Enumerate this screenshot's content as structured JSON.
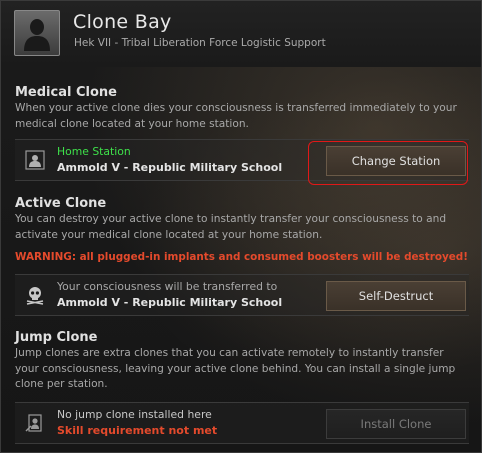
{
  "window": {
    "title": "Clone Bay",
    "subtitle": "Hek VII - Tribal Liberation Force Logistic Support"
  },
  "medical": {
    "title": "Medical Clone",
    "description": "When your active clone dies your consciousness is transferred immediately to your medical clone located at your home station.",
    "label": "Home Station",
    "station": "Ammold V - Republic Military School",
    "button": "Change Station"
  },
  "active": {
    "title": "Active Clone",
    "description": "You can destroy your active clone to instantly transfer your consciousness to and activate your medical clone located at your home station.",
    "warning": "WARNING: all plugged-in implants and consumed boosters will be destroyed!",
    "label": "Your consciousness will be transferred to",
    "station": "Ammold V - Republic Military School",
    "button": "Self-Destruct"
  },
  "jump": {
    "title": "Jump Clone",
    "description": "Jump clones are extra clones that you can activate remotely to instantly transfer your consciousness, leaving your active clone behind. You can install a single jump clone per station.",
    "label": "No jump clone installed here",
    "requirement": "Skill requirement not met",
    "button": "Install Clone"
  },
  "colors": {
    "home_station": "#3ee04a",
    "warning": "#e44a2c",
    "highlight": "#e01818"
  }
}
